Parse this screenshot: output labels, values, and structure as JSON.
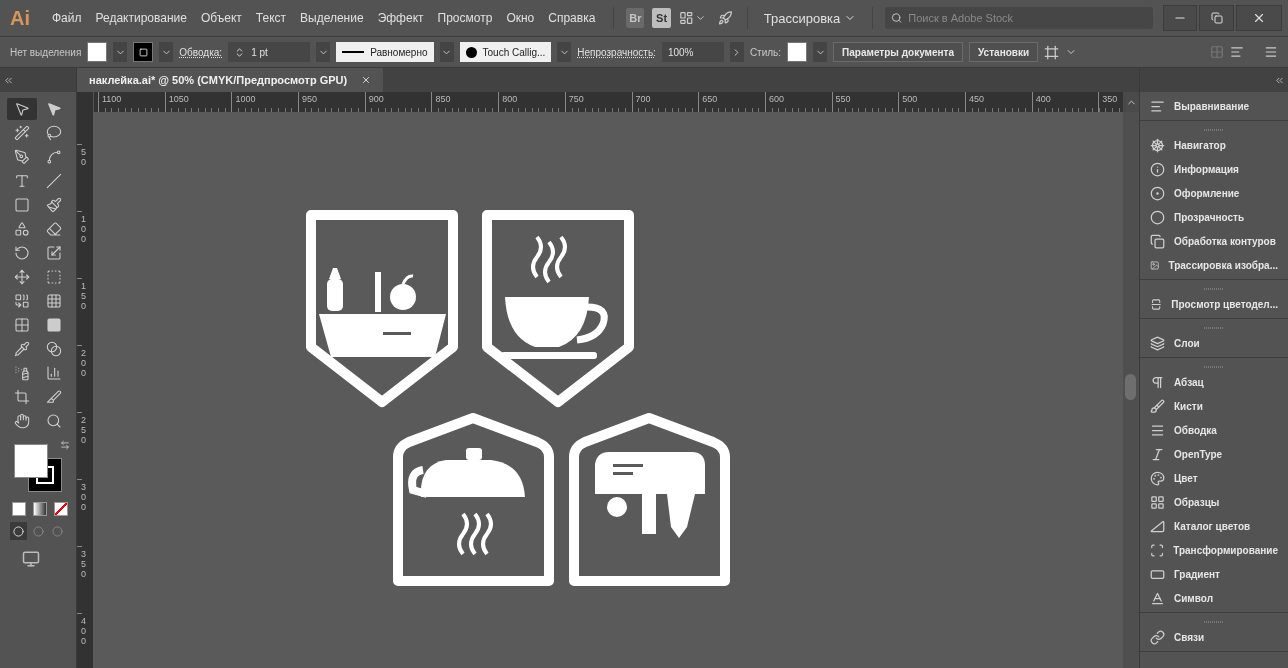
{
  "menubar": {
    "logo": "Ai",
    "menus": [
      "Файл",
      "Редактирование",
      "Объект",
      "Текст",
      "Выделение",
      "Эффект",
      "Просмотр",
      "Окно",
      "Справка"
    ],
    "app_buttons": [
      "Br",
      "St"
    ],
    "workspace": "Трассировка",
    "search": {
      "placeholder": "Поиск в Adobe Stock"
    }
  },
  "control_bar": {
    "selection": "Нет выделения",
    "stroke_label": "Обводка:",
    "stroke_weight": "1 pt",
    "profile": "Равномерно",
    "brush": "Touch Callig...",
    "opacity_label": "Непрозрачность:",
    "opacity": "100%",
    "style_label": "Стиль:",
    "buttons": [
      "Параметры документа",
      "Установки"
    ]
  },
  "document_tabs": [
    {
      "title": "наклейка.ai* @ 50% (CMYK/Предпросмотр GPU)",
      "selected": true
    }
  ],
  "ruler": {
    "horizontal": [
      "1100",
      "1050",
      "1000",
      "950",
      "900",
      "850",
      "800",
      "750",
      "700",
      "650",
      "600",
      "550",
      "500",
      "450",
      "400",
      "350"
    ],
    "vertical": [
      "50",
      "100",
      "150",
      "200",
      "250",
      "300",
      "350",
      "400"
    ]
  },
  "tools": [
    {
      "selected": true
    },
    {
      "selected": false
    },
    {
      "selected": false
    },
    {
      "selected": false
    },
    {
      "selected": false
    },
    {
      "selected": false
    },
    {
      "selected": false
    },
    {
      "selected": false
    },
    {
      "selected": false
    },
    {
      "selected": false
    },
    {
      "selected": false
    },
    {
      "selected": false
    },
    {
      "selected": false
    },
    {
      "selected": false
    },
    {
      "selected": false
    },
    {
      "selected": false
    },
    {
      "selected": false
    },
    {
      "selected": false
    },
    {
      "selected": false
    },
    {
      "selected": false
    },
    {
      "selected": false
    },
    {
      "selected": false
    },
    {
      "selected": false
    },
    {
      "selected": false
    },
    {
      "selected": false
    },
    {
      "selected": false
    },
    {
      "selected": false
    },
    {
      "selected": false
    }
  ],
  "draw_modes": [
    {
      "selected": true
    },
    {
      "selected": false
    },
    {
      "selected": false
    }
  ],
  "panels": [
    {
      "items": [
        "Выравнивание"
      ]
    },
    {
      "items": [
        "Навигатор",
        "Информация",
        "Оформление",
        "Прозрачность",
        "Обработка контуров",
        "Трассировка изобра..."
      ]
    },
    {
      "items": [
        "Просмотр цветодел..."
      ]
    },
    {
      "items": [
        "Слои"
      ]
    },
    {
      "items": [
        "Абзац",
        "Кисти",
        "Обводка",
        "OpenType",
        "Цвет",
        "Образцы",
        "Каталог цветов",
        "Трансформирование",
        "Градиент",
        "Символ"
      ]
    },
    {
      "items": [
        "Связи"
      ]
    }
  ]
}
